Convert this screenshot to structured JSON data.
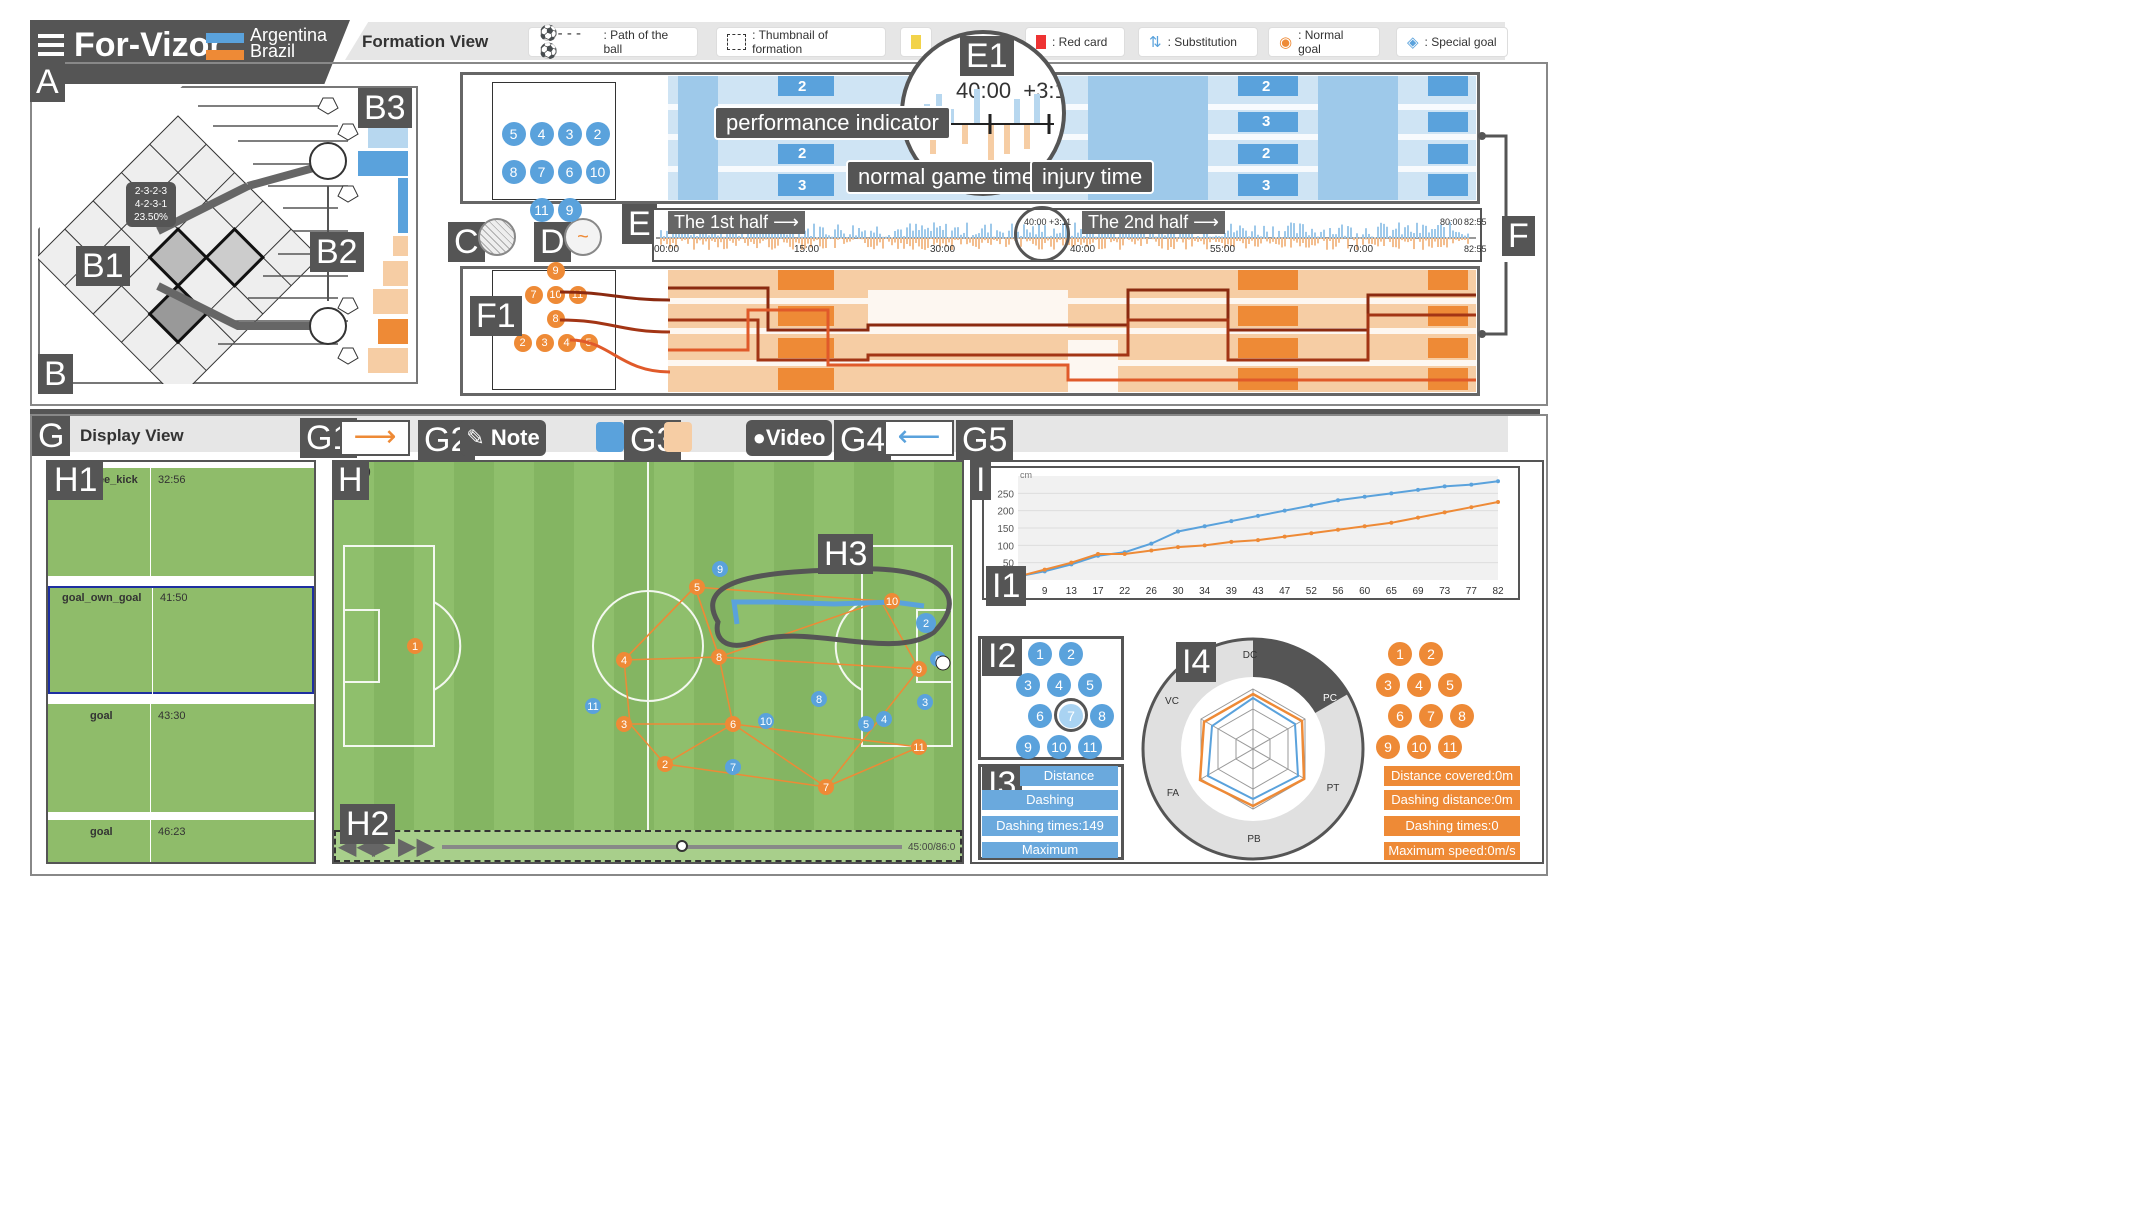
{
  "app": {
    "title": "For-Vizor",
    "team1": "Argentina",
    "team2": "Brazil",
    "team1_color": "#5aa2dc",
    "team2_color": "#ee8a36"
  },
  "formation_view": {
    "title": "Formation View"
  },
  "legend": [
    {
      "icon": "ball-path-icon",
      "label": ": Path of the ball"
    },
    {
      "icon": "formation-thumbnail-icon",
      "label": ": Thumbnail of formation"
    },
    {
      "icon": "yellow-card-icon",
      "label": ""
    },
    {
      "icon": "red-card-icon",
      "label": ": Red card"
    },
    {
      "icon": "substitution-icon",
      "label": ": Substitution"
    },
    {
      "icon": "normal-goal-icon",
      "label": ": Normal goal"
    },
    {
      "icon": "special-goal-icon",
      "label": ": Special goal"
    }
  ],
  "labels": {
    "A": "A",
    "B": "B",
    "B1": "B1",
    "B2": "B2",
    "B3": "B3",
    "C": "C",
    "D": "D",
    "E": "E",
    "E1": "E1",
    "F": "F",
    "F1": "F1",
    "G": "G",
    "G1": "G1",
    "G2": "G2",
    "G3": "G3",
    "G4": "G4",
    "G5": "G5",
    "H": "H",
    "H1": "H1",
    "H2": "H2",
    "H3": "H3",
    "I": "I",
    "I1": "I1",
    "I2": "I2",
    "I3": "I3",
    "I4": "I4"
  },
  "tooltip": {
    "line1": "2-3-2-3",
    "line2": "4-2-3-1",
    "line3": "23.50%"
  },
  "callouts": {
    "performance": "performance indicator",
    "normal_time": "normal game time",
    "injury_time": "injury time",
    "zoom_time": "40:00",
    "zoom_plus": "+3:1"
  },
  "timeline": {
    "first_half": "The 1st half",
    "second_half": "The 2nd half",
    "ticks": [
      "00:00",
      "15:00",
      "30:00",
      "40:00 +3:11",
      "40:00",
      "55:00",
      "70:00",
      "80:00",
      "82:55",
      "82:55"
    ]
  },
  "blue_bands": [
    "2",
    "3",
    "2",
    "3",
    "2",
    "3",
    "2",
    "3"
  ],
  "blue_formation": {
    "rows": [
      [
        "5",
        "4",
        "3",
        "2"
      ],
      [
        "8",
        "7",
        "6",
        "10"
      ],
      [
        "11",
        "9"
      ]
    ]
  },
  "orange_formation": {
    "rows": [
      [
        "9"
      ],
      [
        "7",
        "10",
        "11"
      ],
      [
        "8"
      ],
      [
        "2",
        "3",
        "4",
        "5"
      ]
    ]
  },
  "display_view": {
    "title": "Display View",
    "note": "Note",
    "video": "Video"
  },
  "clips": [
    {
      "name": "free_kick",
      "time": "32:56"
    },
    {
      "name": "goal_own_goal",
      "time": "41:50"
    },
    {
      "name": "goal",
      "time": "43:30"
    },
    {
      "name": "goal",
      "time": "46:23"
    }
  ],
  "pitch": {
    "corner": "50",
    "time": "45:00/86:0"
  },
  "chart_data": {
    "type": "line",
    "title": "",
    "ylabel": "cm",
    "x": [
      "4",
      "9",
      "13",
      "17",
      "22",
      "26",
      "30",
      "34",
      "39",
      "43",
      "47",
      "52",
      "56",
      "60",
      "65",
      "69",
      "73",
      "77",
      "82"
    ],
    "ylim": [
      0,
      300
    ],
    "yticks": [
      "250",
      "200",
      "150",
      "100",
      "50"
    ],
    "series": [
      {
        "color": "#5aa2dc",
        "values": [
          10,
          25,
          45,
          70,
          80,
          105,
          140,
          155,
          170,
          185,
          200,
          215,
          230,
          240,
          250,
          260,
          270,
          275,
          285
        ]
      },
      {
        "color": "#ee8a36",
        "values": [
          10,
          30,
          50,
          75,
          75,
          85,
          95,
          100,
          110,
          115,
          125,
          135,
          145,
          155,
          165,
          180,
          195,
          210,
          225
        ]
      }
    ]
  },
  "players_blue": [
    "1",
    "2",
    "3",
    "4",
    "5",
    "6",
    "7",
    "8",
    "9",
    "10",
    "11"
  ],
  "players_orange": [
    "1",
    "2",
    "3",
    "4",
    "5",
    "6",
    "7",
    "8",
    "9",
    "10",
    "11"
  ],
  "stats_blue": [
    "Distance",
    "Dashing distance:1072m",
    "Dashing times:149",
    "Maximum"
  ],
  "stats_orange": [
    "Distance covered:0m",
    "Dashing distance:0m",
    "Dashing times:0",
    "Maximum speed:0m/s"
  ],
  "radar": {
    "axes": [
      "DC",
      "PC",
      "PT",
      "PB",
      "FA",
      "VC"
    ]
  }
}
